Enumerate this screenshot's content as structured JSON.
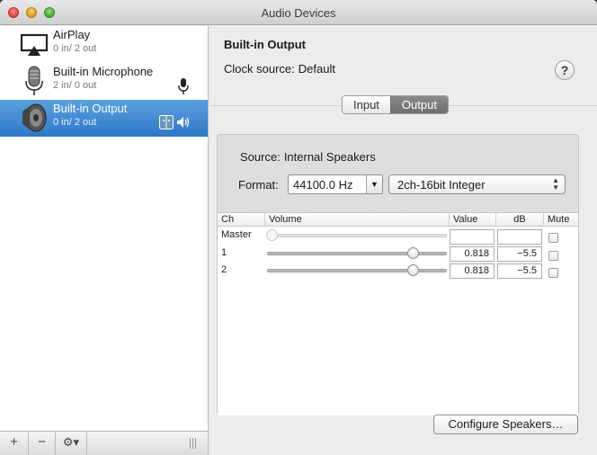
{
  "window": {
    "title": "Audio Devices"
  },
  "devices": [
    {
      "name": "AirPlay",
      "io": "0 in/ 2 out",
      "icon": "airplay-icon"
    },
    {
      "name": "Built-in Microphone",
      "io": "2 in/ 0 out",
      "icon": "microphone-icon"
    },
    {
      "name": "Built-in Output",
      "io": "0 in/ 2 out",
      "icon": "speaker-icon"
    }
  ],
  "bottom_bar": {
    "add": "+",
    "remove": "−",
    "gear": "⚙▾"
  },
  "detail": {
    "title": "Built-in Output",
    "clock_label": "Clock source:",
    "clock_value": "Default",
    "help": "?"
  },
  "tabs": {
    "input": "Input",
    "output": "Output",
    "selected": "output"
  },
  "output": {
    "source_label": "Source:",
    "source_value": "Internal Speakers",
    "format_label": "Format:",
    "sample_rate": "44100.0 Hz",
    "format": "2ch-16bit Integer"
  },
  "table": {
    "headers": [
      "Ch",
      "Volume",
      "Value",
      "dB",
      "Mute"
    ],
    "rows": [
      {
        "ch": "Master",
        "volume": 0,
        "value": "",
        "db": "",
        "mute": false,
        "enabled": false
      },
      {
        "ch": "1",
        "volume": 0.818,
        "value": "0.818",
        "db": "−5.5",
        "mute": false,
        "enabled": true
      },
      {
        "ch": "2",
        "volume": 0.818,
        "value": "0.818",
        "db": "−5.5",
        "mute": false,
        "enabled": true
      }
    ]
  },
  "configure_button": "Configure Speakers…"
}
